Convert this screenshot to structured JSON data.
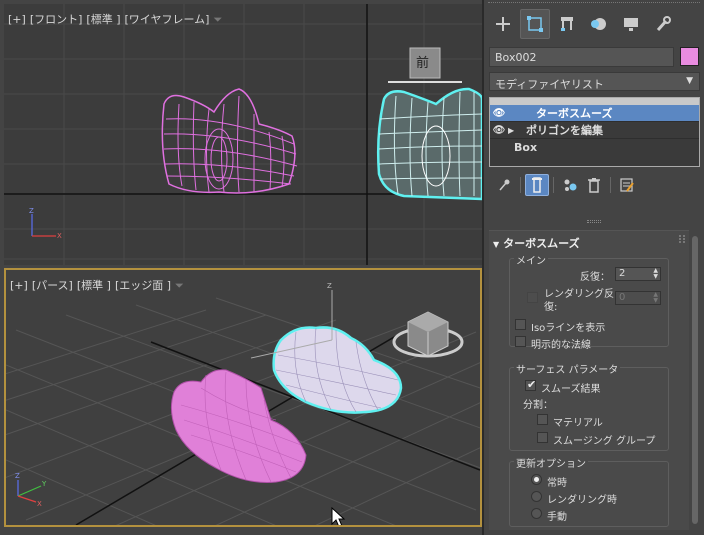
{
  "viewport_front": {
    "label_parts": [
      "[+]",
      "[フロント]",
      "[標準 ]",
      "[ワイヤフレーム]"
    ],
    "viewcube_label": "前"
  },
  "viewport_persp": {
    "label_parts": [
      "[+]",
      "[パース]",
      "[標準 ]",
      "[エッジ面 ]"
    ]
  },
  "command_panel": {
    "tabs": [
      "create-icon",
      "modify-icon",
      "hierarchy-icon",
      "motion-icon",
      "display-icon",
      "utilities-icon"
    ],
    "active_tab": "modify-icon",
    "object_name": "Box002",
    "object_color": "#e98ce0",
    "modifier_list": "モディファイヤリスト",
    "stack": [
      {
        "label": "ターボスムーズ",
        "selected": true
      },
      {
        "label": "ポリゴンを編集",
        "selected": false
      },
      {
        "label": "Box",
        "selected": false
      }
    ],
    "turbosmooth": {
      "title": "ターボスムーズ",
      "main_group": "メイン",
      "iterations_label": "反復：",
      "iterations_value": "2",
      "render_iters_label_1": "レンダリング反",
      "render_iters_label_2": "復:",
      "render_iters_value": "0",
      "isoline_label": "Isoラインを表示",
      "explicit_normals_label": "明示的な法線",
      "surface_group": "サーフェス パラメータ",
      "smooth_result_label": "スムーズ結果",
      "separate_label": "分割：",
      "materials_label": "マテリアル",
      "smoothing_groups_label": "スムージング グループ",
      "update_group": "更新オプション",
      "always_label": "常時",
      "when_rendering_label": "レンダリング時",
      "manually_label": "手動"
    }
  },
  "colors": {
    "selection_cyan": "#5ff0f0",
    "wire_pink": "#e070e0",
    "stack_selected": "#5b87c2",
    "active_viewport_border": "#b3913e"
  }
}
